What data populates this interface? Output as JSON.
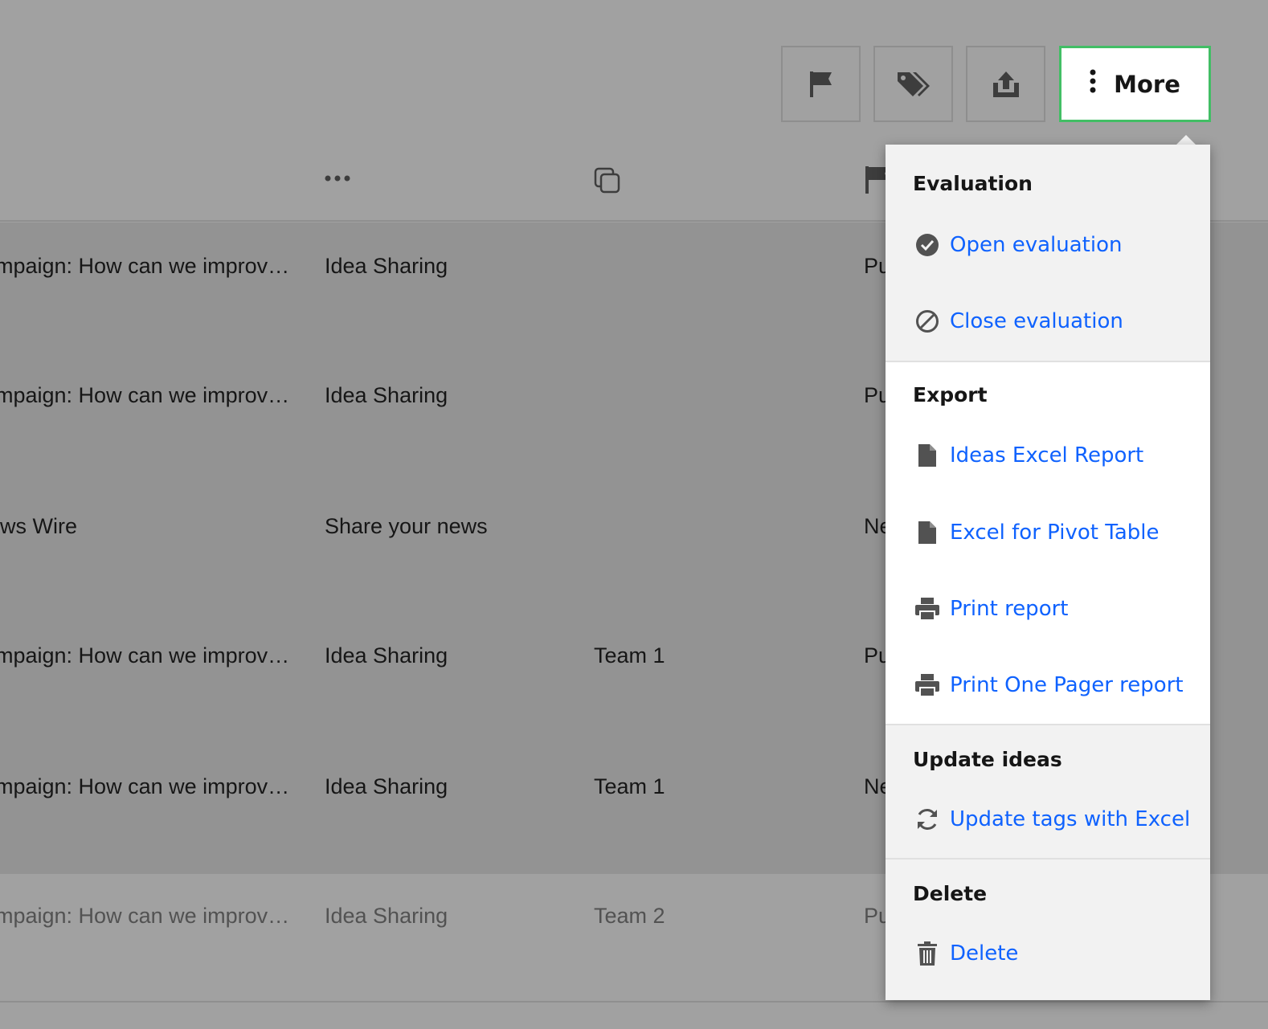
{
  "toolbar": {
    "flag_icon": "flag-icon",
    "tag_icon": "tag-icon",
    "export_icon": "export-icon",
    "more_label": "More",
    "more_icon": "overflow-menu-vertical-icon",
    "colors": {
      "more_border": "#42be65",
      "background": "#a1a1a1"
    }
  },
  "table": {
    "header_icons": [
      "overflow-menu-horizontal-icon",
      "copy-icon",
      "flag-icon"
    ],
    "rows": [
      {
        "campaign": "mpaign: How can we improv…",
        "community": "Idea Sharing",
        "team": "",
        "status": "Pu"
      },
      {
        "campaign": "mpaign: How can we improv…",
        "community": "Idea Sharing",
        "team": "",
        "status": "Pu"
      },
      {
        "campaign": "ws Wire",
        "community": "Share your news",
        "team": "",
        "status": "Ne"
      },
      {
        "campaign": "mpaign: How can we improv…",
        "community": "Idea Sharing",
        "team": "Team 1",
        "status": "Pu"
      },
      {
        "campaign": "mpaign: How can we improv…",
        "community": "Idea Sharing",
        "team": "Team 1",
        "status": "Ne"
      },
      {
        "campaign": "mpaign: How can we improv…",
        "community": "Idea Sharing",
        "team": "Team 2",
        "status": "Pu"
      }
    ]
  },
  "dropdown": {
    "link_color": "#0f62fe",
    "sections": [
      {
        "title": "Evaluation",
        "items": [
          {
            "label": "Open evaluation",
            "icon": "checkmark-filled-icon"
          },
          {
            "label": "Close evaluation",
            "icon": "blocked-icon"
          }
        ]
      },
      {
        "title": "Export",
        "items": [
          {
            "label": "Ideas Excel Report",
            "icon": "document-icon"
          },
          {
            "label": "Excel for Pivot Table",
            "icon": "document-icon"
          },
          {
            "label": "Print report",
            "icon": "printer-icon"
          },
          {
            "label": "Print One Pager report",
            "icon": "printer-icon"
          }
        ]
      },
      {
        "title": "Update ideas",
        "items": [
          {
            "label": "Update tags with Excel",
            "icon": "refresh-icon"
          }
        ]
      },
      {
        "title": "Delete",
        "items": [
          {
            "label": "Delete",
            "icon": "trash-icon"
          }
        ]
      }
    ]
  }
}
